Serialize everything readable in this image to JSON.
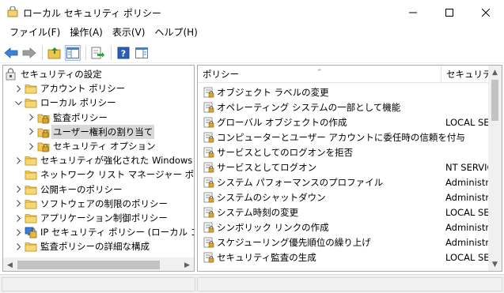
{
  "window": {
    "title": "ローカル セキュリティ ポリシー",
    "minimize": "—",
    "maximize": "☐",
    "close": "✕"
  },
  "menu": [
    {
      "label": "ファイル(F)"
    },
    {
      "label": "操作(A)"
    },
    {
      "label": "表示(V)"
    },
    {
      "label": "ヘルプ(H)"
    }
  ],
  "toolbar": {
    "buttons": [
      "back-icon",
      "forward-icon",
      "up-folder-icon",
      "show-hide-tree-icon",
      "export-list-icon",
      "help-icon",
      "properties-pane-icon"
    ]
  },
  "tree": [
    {
      "label": "セキュリティの設定",
      "level": 0,
      "expander": "",
      "icon": "security-root-icon"
    },
    {
      "label": "アカウント ポリシー",
      "level": 1,
      "expander": "›",
      "icon": "folder-icon"
    },
    {
      "label": "ローカル ポリシー",
      "level": 1,
      "expander": "⌄",
      "icon": "folder-icon"
    },
    {
      "label": "監査ポリシー",
      "level": 2,
      "expander": "›",
      "icon": "policy-folder-icon"
    },
    {
      "label": "ユーザー権利の割り当て",
      "level": 2,
      "expander": "›",
      "icon": "policy-folder-icon",
      "selected": true
    },
    {
      "label": "セキュリティ オプション",
      "level": 2,
      "expander": "›",
      "icon": "policy-folder-icon"
    },
    {
      "label": "セキュリティが強化された Windows Defer",
      "level": 1,
      "expander": "›",
      "icon": "folder-icon"
    },
    {
      "label": "ネットワーク リスト マネージャー ポリシー",
      "level": 1,
      "expander": "",
      "icon": "folder-icon"
    },
    {
      "label": "公開キーのポリシー",
      "level": 1,
      "expander": "›",
      "icon": "folder-icon"
    },
    {
      "label": "ソフトウェアの制限のポリシー",
      "level": 1,
      "expander": "›",
      "icon": "folder-icon"
    },
    {
      "label": "アプリケーション制御ポリシー",
      "level": 1,
      "expander": "›",
      "icon": "folder-icon"
    },
    {
      "label": "IP セキュリティ ポリシー (ローカル コンピュータ",
      "level": 1,
      "expander": "›",
      "icon": "ip-security-icon"
    },
    {
      "label": "監査ポリシーの詳細な構成",
      "level": 1,
      "expander": "›",
      "icon": "folder-icon"
    }
  ],
  "list": {
    "columns": [
      "ポリシー",
      "セキュリティ"
    ],
    "rows": [
      {
        "policy": "オブジェクト ラベルの変更",
        "security": ""
      },
      {
        "policy": "オペレーティング システムの一部として機能",
        "security": ""
      },
      {
        "policy": "グローバル オブジェクトの作成",
        "security": "LOCAL SEI"
      },
      {
        "policy": "コンピューターとユーザー アカウントに委任時の信頼を付与",
        "security": ""
      },
      {
        "policy": "サービスとしてのログオンを拒否",
        "security": ""
      },
      {
        "policy": "サービスとしてログオン",
        "security": "NT SERVIC"
      },
      {
        "policy": "システム パフォーマンスのプロファイル",
        "security": "Administra"
      },
      {
        "policy": "システムのシャットダウン",
        "security": "Administra"
      },
      {
        "policy": "システム時刻の変更",
        "security": "LOCAL SEI"
      },
      {
        "policy": "シンボリック リンクの作成",
        "security": "Administra"
      },
      {
        "policy": "スケジューリング優先順位の繰り上げ",
        "security": "Administra"
      },
      {
        "policy": "セキュリティ監査の生成",
        "security": "LOCAL SEI"
      }
    ]
  },
  "colors": {
    "selected_bg": "#d9d9d9",
    "folder": "#e8c15a",
    "lock": "#c99a1c",
    "help": "#2a5fb8"
  }
}
